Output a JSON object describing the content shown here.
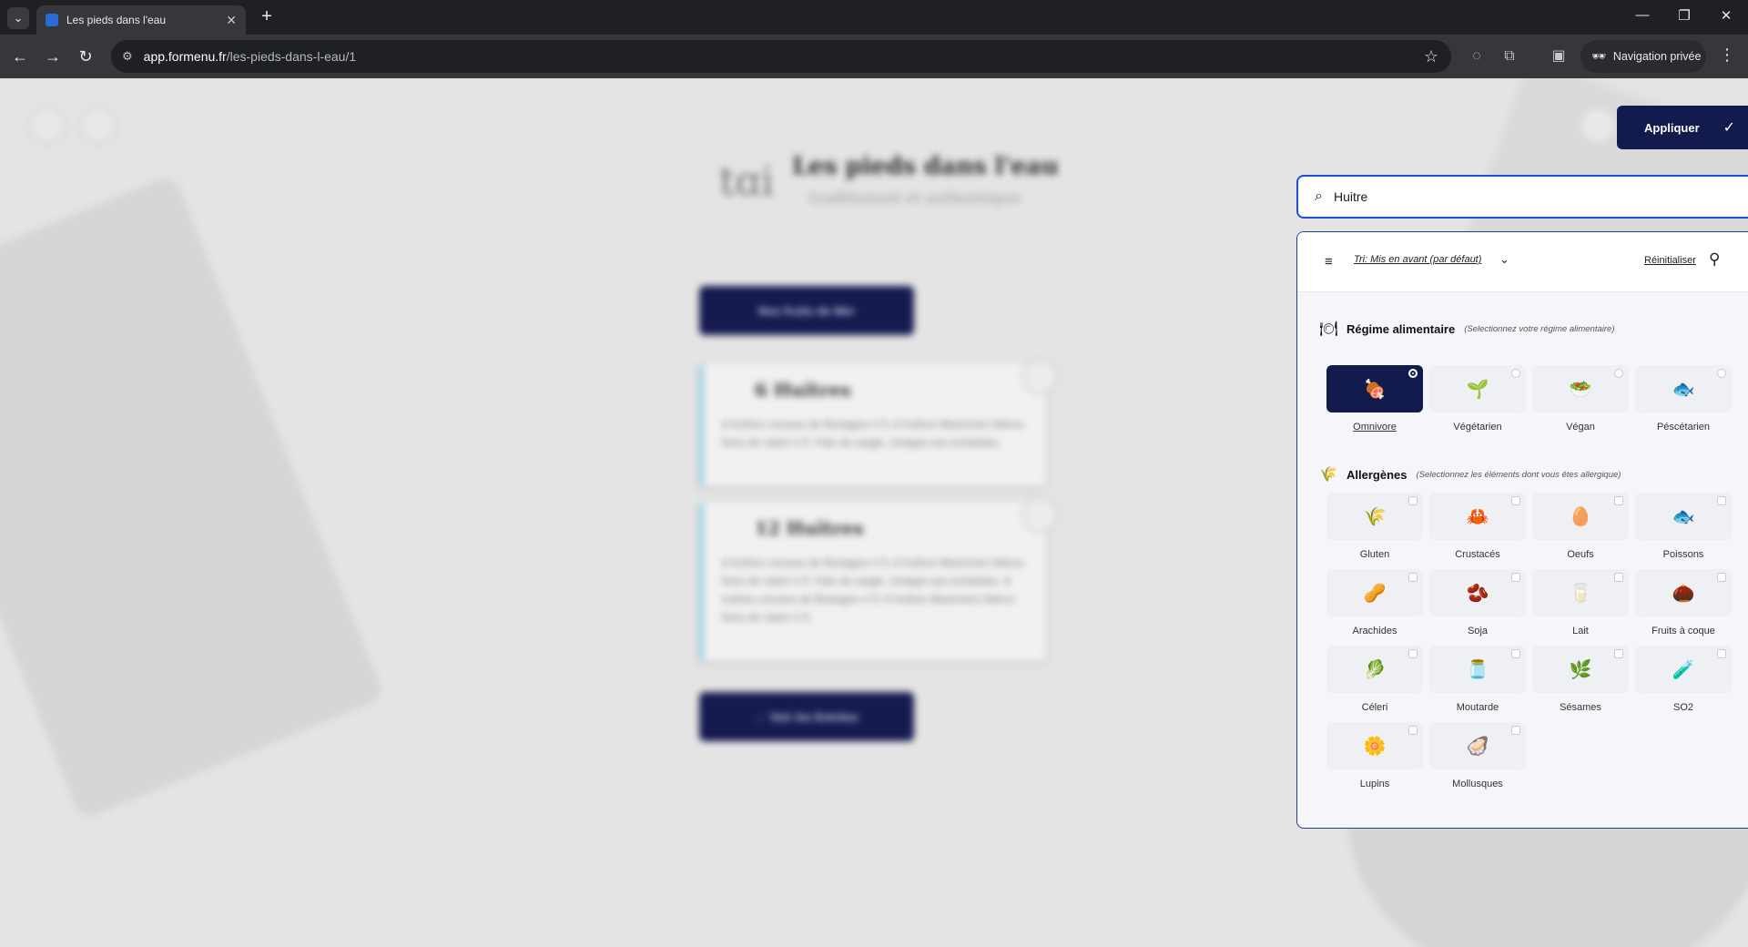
{
  "browser": {
    "tab_title": "Les pieds dans l'eau",
    "url_host": "app.formenu.fr",
    "url_path": "/les-pieds-dans-l-eau/1",
    "private_label": "Navigation privée"
  },
  "page": {
    "brand_title": "Les pieds dans l'eau",
    "brand_sub": "traditionnel et authentique",
    "top_button": "Nos fruits de Mer",
    "cards": [
      {
        "title": "6 Huîtres",
        "desc": "6 huîtres creuses de Bretagne n°3, 6 huîtres Marennes Oléron fines de claire n°3. Pain de seigle, vinaigre aux échalotes."
      },
      {
        "title": "12 Huîtres",
        "desc": "6 huîtres creuses de Bretagne n°3, 6 huîtres Marennes Oléron fines de claire n°3. Pain de seigle, vinaigre aux échalotes. 6 huîtres creuses de Bretagne n°3, 6 huîtres Marennes Oléron fines de claire n°3."
      }
    ],
    "bottom_button": "← Voir les Entrées"
  },
  "apply_label": "Appliquer",
  "search": {
    "value": "Huitre"
  },
  "panel": {
    "sort_label": "Tri: Mis en avant (par défaut)",
    "reset_label": "Réinitialiser",
    "diet": {
      "title": "Régime alimentaire",
      "hint": "(Selectionnez votre régime alimentaire)",
      "options": [
        {
          "label": "Omnivore",
          "icon": "🍖",
          "selected": true
        },
        {
          "label": "Végétarien",
          "icon": "🌱",
          "selected": false
        },
        {
          "label": "Végan",
          "icon": "🥗",
          "selected": false
        },
        {
          "label": "Péscétarien",
          "icon": "🐟",
          "selected": false
        }
      ]
    },
    "allergens": {
      "title": "Allergènes",
      "hint": "(Selectionnez les éléments dont vous êtes allergique)",
      "options": [
        {
          "label": "Gluten",
          "icon": "🌾"
        },
        {
          "label": "Crustacés",
          "icon": "🦀"
        },
        {
          "label": "Oeufs",
          "icon": "🥚"
        },
        {
          "label": "Poissons",
          "icon": "🐟"
        },
        {
          "label": "Arachides",
          "icon": "🥜"
        },
        {
          "label": "Soja",
          "icon": "🫘"
        },
        {
          "label": "Lait",
          "icon": "🥛"
        },
        {
          "label": "Fruits à coque",
          "icon": "🌰"
        },
        {
          "label": "Céleri",
          "icon": "🥬"
        },
        {
          "label": "Moutarde",
          "icon": "🫙"
        },
        {
          "label": "Sésames",
          "icon": "🌿"
        },
        {
          "label": "SO2",
          "icon": "🧪"
        },
        {
          "label": "Lupins",
          "icon": "🌼"
        },
        {
          "label": "Mollusques",
          "icon": "🦪"
        }
      ]
    }
  }
}
